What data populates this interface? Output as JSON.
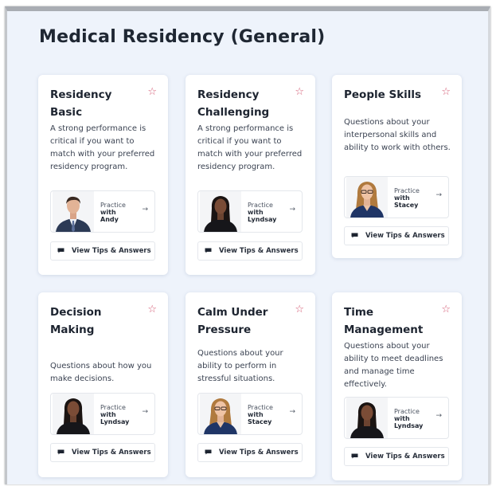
{
  "page": {
    "title": "Medical Residency (General)"
  },
  "practice_prefix": "Practice",
  "practice_with": "with",
  "tips_label": "View Tips & Answers",
  "colors": {
    "star": "#d45b74",
    "background": "#eef3fb",
    "card": "#ffffff"
  },
  "cards": [
    {
      "title": "Residency Basic",
      "description": "A strong performance is critical if you want to match with your preferred residency program.",
      "coach": "Andy",
      "favorite_icon": "star-outline-icon"
    },
    {
      "title": "Residency Challenging",
      "description": "A strong performance is critical if you want to match with your preferred residency program.",
      "coach": "Lyndsay",
      "favorite_icon": "star-outline-icon"
    },
    {
      "title": "People Skills",
      "description": "Questions about your interpersonal skills and ability to work with others.",
      "coach": "Stacey",
      "favorite_icon": "star-outline-icon"
    },
    {
      "title": "Decision Making",
      "description": "Questions about how you make decisions.",
      "coach": "Lyndsay",
      "favorite_icon": "star-outline-icon"
    },
    {
      "title": "Calm Under Pressure",
      "description": "Questions about your ability to perform in stressful situations.",
      "coach": "Stacey",
      "favorite_icon": "star-outline-icon"
    },
    {
      "title": "Time Management",
      "description": "Questions about your ability to meet deadlines and manage time effectively.",
      "coach": "Lyndsay",
      "favorite_icon": "star-outline-icon"
    }
  ]
}
